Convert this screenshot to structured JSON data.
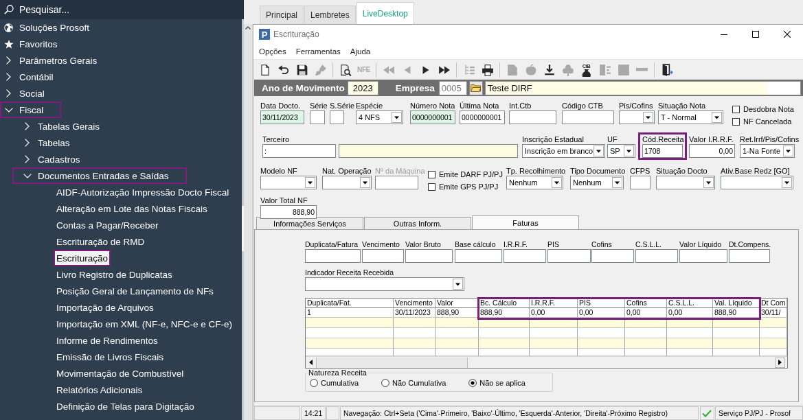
{
  "sidebar": {
    "search": {
      "placeholder": "Pesquisar..."
    },
    "items": [
      {
        "kind": "shortcut",
        "label": "Soluções Prosoft",
        "highlighted": false
      },
      {
        "kind": "shortcut",
        "label": "Favoritos",
        "highlighted": false
      },
      {
        "kind": "folder",
        "label": "Parâmetros Gerais",
        "expanded": false,
        "highlighted": false
      },
      {
        "kind": "folder",
        "label": "Contábil",
        "expanded": false,
        "highlighted": false
      },
      {
        "kind": "folder",
        "label": "Social",
        "expanded": false,
        "highlighted": false
      },
      {
        "kind": "folder",
        "label": "Fiscal",
        "expanded": true,
        "highlighted": true,
        "children": [
          {
            "kind": "folder",
            "label": "Tabelas Gerais",
            "expanded": false,
            "highlighted": false
          },
          {
            "kind": "folder",
            "label": "Tabelas",
            "expanded": false,
            "highlighted": false
          },
          {
            "kind": "folder",
            "label": "Cadastros",
            "expanded": false,
            "highlighted": false
          },
          {
            "kind": "folder",
            "label": "Documentos Entradas e Saídas",
            "expanded": true,
            "highlighted": true,
            "children": [
              {
                "kind": "leaf",
                "label": "AIDF-Autorização Impressão Docto Fiscal",
                "selected": false,
                "highlighted": false
              },
              {
                "kind": "leaf",
                "label": "Alteração em Lote das Notas Fiscais",
                "selected": false,
                "highlighted": false
              },
              {
                "kind": "leaf",
                "label": "Contas a Pagar/Receber",
                "selected": false,
                "highlighted": false
              },
              {
                "kind": "leaf",
                "label": "Escrituração de RMD",
                "selected": false,
                "highlighted": false
              },
              {
                "kind": "leaf",
                "label": "Escrituração",
                "selected": true,
                "highlighted": true
              },
              {
                "kind": "leaf",
                "label": "Livro Registro de Duplicatas",
                "selected": false,
                "highlighted": false
              },
              {
                "kind": "leaf",
                "label": "Posição Geral de Lançamento de NFs",
                "selected": false,
                "highlighted": false
              },
              {
                "kind": "leaf",
                "label": "Importação de Arquivos",
                "selected": false,
                "highlighted": false
              },
              {
                "kind": "leaf",
                "label": "Importação em XML (NF-e, NFC-e e CF-e)",
                "selected": false,
                "highlighted": false
              },
              {
                "kind": "leaf",
                "label": "Informe de Rendimentos",
                "selected": false,
                "highlighted": false
              },
              {
                "kind": "leaf",
                "label": "Emissão de Livros Fiscais",
                "selected": false,
                "highlighted": false
              },
              {
                "kind": "leaf",
                "label": "Movimentação de Combustível",
                "selected": false,
                "highlighted": false
              },
              {
                "kind": "leaf",
                "label": "Relatórios Adicionais",
                "selected": false,
                "highlighted": false
              },
              {
                "kind": "leaf",
                "label": "Definição de Telas para Digitação",
                "selected": false,
                "highlighted": false
              }
            ]
          }
        ]
      }
    ]
  },
  "workspace_tabs": [
    {
      "label": "Principal",
      "selected": false
    },
    {
      "label": "Lembretes",
      "selected": false
    },
    {
      "label": "LiveDesktop",
      "selected": true
    }
  ],
  "window": {
    "logo": "P",
    "title": "Escrituração",
    "menu": [
      "Opções",
      "Ferramentas",
      "Ajuda"
    ],
    "toolbar": [
      {
        "buttons": [
          {
            "kind": "new",
            "disabled": false
          },
          {
            "kind": "undo",
            "disabled": false
          },
          {
            "kind": "save",
            "disabled": false
          },
          {
            "kind": "brush",
            "disabled": true
          }
        ]
      },
      {
        "buttons": [
          {
            "kind": "preview",
            "disabled": false
          },
          {
            "kind": "nfe",
            "label": "NFE",
            "disabled": true
          }
        ]
      },
      {
        "buttons": [
          {
            "kind": "first",
            "disabled": true
          },
          {
            "kind": "previous",
            "disabled": true
          },
          {
            "kind": "next",
            "disabled": false
          },
          {
            "kind": "last",
            "disabled": false
          }
        ]
      },
      {
        "buttons": [
          {
            "kind": "tree",
            "disabled": true
          },
          {
            "kind": "print",
            "disabled": false
          }
        ]
      },
      {
        "buttons": [
          {
            "kind": "document",
            "disabled": true
          },
          {
            "kind": "apple",
            "disabled": true
          },
          {
            "kind": "download",
            "disabled": false
          },
          {
            "kind": "club",
            "disabled": true
          },
          {
            "kind": "bag",
            "label": "CIB",
            "disabled": false
          },
          {
            "kind": "split",
            "disabled": true
          },
          {
            "kind": "block",
            "disabled": true
          },
          {
            "kind": "minus",
            "disabled": true
          }
        ]
      },
      {
        "buttons": [
          {
            "kind": "exit",
            "disabled": false
          }
        ]
      }
    ],
    "header": {
      "year": {
        "label": "Ano de Movimento",
        "value": "2023",
        "color": "#fffde6"
      },
      "company": {
        "label": "Empresa",
        "code": {
          "value": "0005",
          "disabled": true
        },
        "name": {
          "value": "Teste DIRF",
          "color": "#fffde6"
        }
      }
    },
    "form": {
      "rows": [
        {
          "fields": [
            {
              "kind": "text",
              "label": "Data Docto.",
              "value": "30/11/2023",
              "color": "#dcf5e4",
              "highlighted": false
            },
            {
              "kind": "text",
              "label": "Série",
              "highlighted": false
            },
            {
              "kind": "text",
              "label": "S.Série",
              "highlighted": false
            },
            {
              "kind": "select",
              "label": "Espécie",
              "value": "4 NFS",
              "highlighted": false
            },
            {
              "kind": "text",
              "label": "Número Nota",
              "value": "0000000001",
              "color": "#dcf5e4",
              "highlighted": false
            },
            {
              "kind": "text",
              "label": "Última Nota",
              "value": "0000000001",
              "highlighted": false
            },
            {
              "kind": "text",
              "label": "Int.Ctb",
              "highlighted": false
            },
            {
              "kind": "text",
              "label": "Código CTB",
              "highlighted": false
            },
            {
              "kind": "select",
              "label": "Pis/Cofins",
              "highlighted": false
            },
            {
              "kind": "select",
              "label": "Situação Nota",
              "value": "T - Normal",
              "highlighted": false
            },
            {
              "kind": "checks",
              "highlighted": false,
              "items": [
                {
                  "label": "Desdobra Nota",
                  "checked": false
                },
                {
                  "label": "NF Cancelada",
                  "checked": false
                }
              ]
            }
          ]
        },
        {
          "fields": [
            {
              "kind": "text",
              "label": "Terceiro",
              "value": ":",
              "highlighted": false
            },
            {
              "kind": "text",
              "color": "#fefde2",
              "highlighted": false
            },
            {
              "kind": "select",
              "label": "Inscrição Estadual",
              "value": "Inscrição em branco",
              "highlighted": false
            },
            {
              "kind": "select",
              "label": "UF",
              "value": "SP",
              "highlighted": false
            },
            {
              "kind": "text",
              "label": "Cód.Receita",
              "value": "1708",
              "highlighted": true
            },
            {
              "kind": "number",
              "label": "Valor I.R.R.F.",
              "value": "0,00",
              "highlighted": false
            },
            {
              "kind": "select",
              "label": "Ret.Irrf/Pis/Cofins",
              "value": "1-Na Fonte",
              "highlighted": false
            }
          ]
        },
        {
          "fields": [
            {
              "kind": "select",
              "label": "Modelo NF",
              "highlighted": false
            },
            {
              "kind": "select",
              "label": "Nat. Operação",
              "highlighted": false
            },
            {
              "kind": "text",
              "label": "Nº da Máquina",
              "disabled": true,
              "highlighted": false
            },
            {
              "kind": "checks",
              "highlighted": false,
              "items": [
                {
                  "label": "Emite DARF PJ/PJ",
                  "checked": false
                },
                {
                  "label": "Emite GPS PJ/PJ",
                  "checked": false
                }
              ]
            },
            {
              "kind": "select",
              "label": "Tp. Recolhimento",
              "value": "Nenhum",
              "highlighted": false
            },
            {
              "kind": "select",
              "label": "Tipo Documento",
              "value": "Nenhum",
              "highlighted": false
            },
            {
              "kind": "text",
              "label": "CFPS",
              "highlighted": false
            },
            {
              "kind": "select",
              "label": "Situação Docto",
              "highlighted": false
            },
            {
              "kind": "select",
              "label": "Ativ.Base Redz [GO]",
              "highlighted": false
            }
          ]
        },
        {
          "fields": [
            {
              "kind": "number",
              "label": "Valor Total NF",
              "value": "888,90",
              "highlighted": false
            }
          ]
        }
      ]
    },
    "tabs": [
      {
        "label": "Informações Serviços",
        "selected": false
      },
      {
        "label": "Outras Inform.",
        "selected": false
      },
      {
        "label": "Faturas",
        "selected": true
      }
    ],
    "faturas": {
      "fields": [
        {
          "label": "Duplicata/Fatura"
        },
        {
          "label": "Vencimento"
        },
        {
          "label": "Valor Bruto"
        },
        {
          "label": "Base cálculo"
        },
        {
          "label": "I.R.R.F."
        },
        {
          "label": "PIS"
        },
        {
          "label": "Cofins"
        },
        {
          "label": "C.S.L.L."
        },
        {
          "label": "Valor Líquido"
        },
        {
          "label": "Dt.Compens."
        }
      ],
      "indicator": {
        "label": "Indicador Receita Recebida"
      },
      "table": {
        "columns": [
          {
            "label": "Duplicata/Fat.",
            "highlighted": false
          },
          {
            "label": "Vencimento",
            "highlighted": false
          },
          {
            "label": "Valor",
            "highlighted": false
          },
          {
            "label": "Bc. Cálculo",
            "highlighted": true
          },
          {
            "label": "I.R.R.F.",
            "highlighted": true
          },
          {
            "label": "PIS",
            "highlighted": true
          },
          {
            "label": "Cofins",
            "highlighted": true
          },
          {
            "label": "C.S.L.L.",
            "highlighted": true
          },
          {
            "label": "Val. Líquido",
            "highlighted": true
          },
          {
            "label": "Dt Com",
            "highlighted": false
          }
        ],
        "rows": [
          {
            "cells": [
              "1",
              "30/11/2023",
              "888,90",
              "888,90",
              "0,00",
              "0,00",
              "0,00",
              "0,00",
              "888,90",
              "30/11/"
            ]
          }
        ]
      },
      "nature": {
        "legend": "Natureza Receita",
        "options": [
          {
            "label": "Cumulativa",
            "selected": false
          },
          {
            "label": "Não Cumulativa",
            "selected": false
          },
          {
            "label": "Não se aplica",
            "selected": true
          }
        ]
      }
    },
    "status_bar": {
      "time": "14:21",
      "message": "Navegação: Ctrl+Seta ('Cima'-Primeiro, 'Baixo'-Último, 'Esquerda'-Anterior, 'Direita'-Próximo Registro)",
      "service": "Serviço PJ/PJ - Prosof"
    }
  }
}
